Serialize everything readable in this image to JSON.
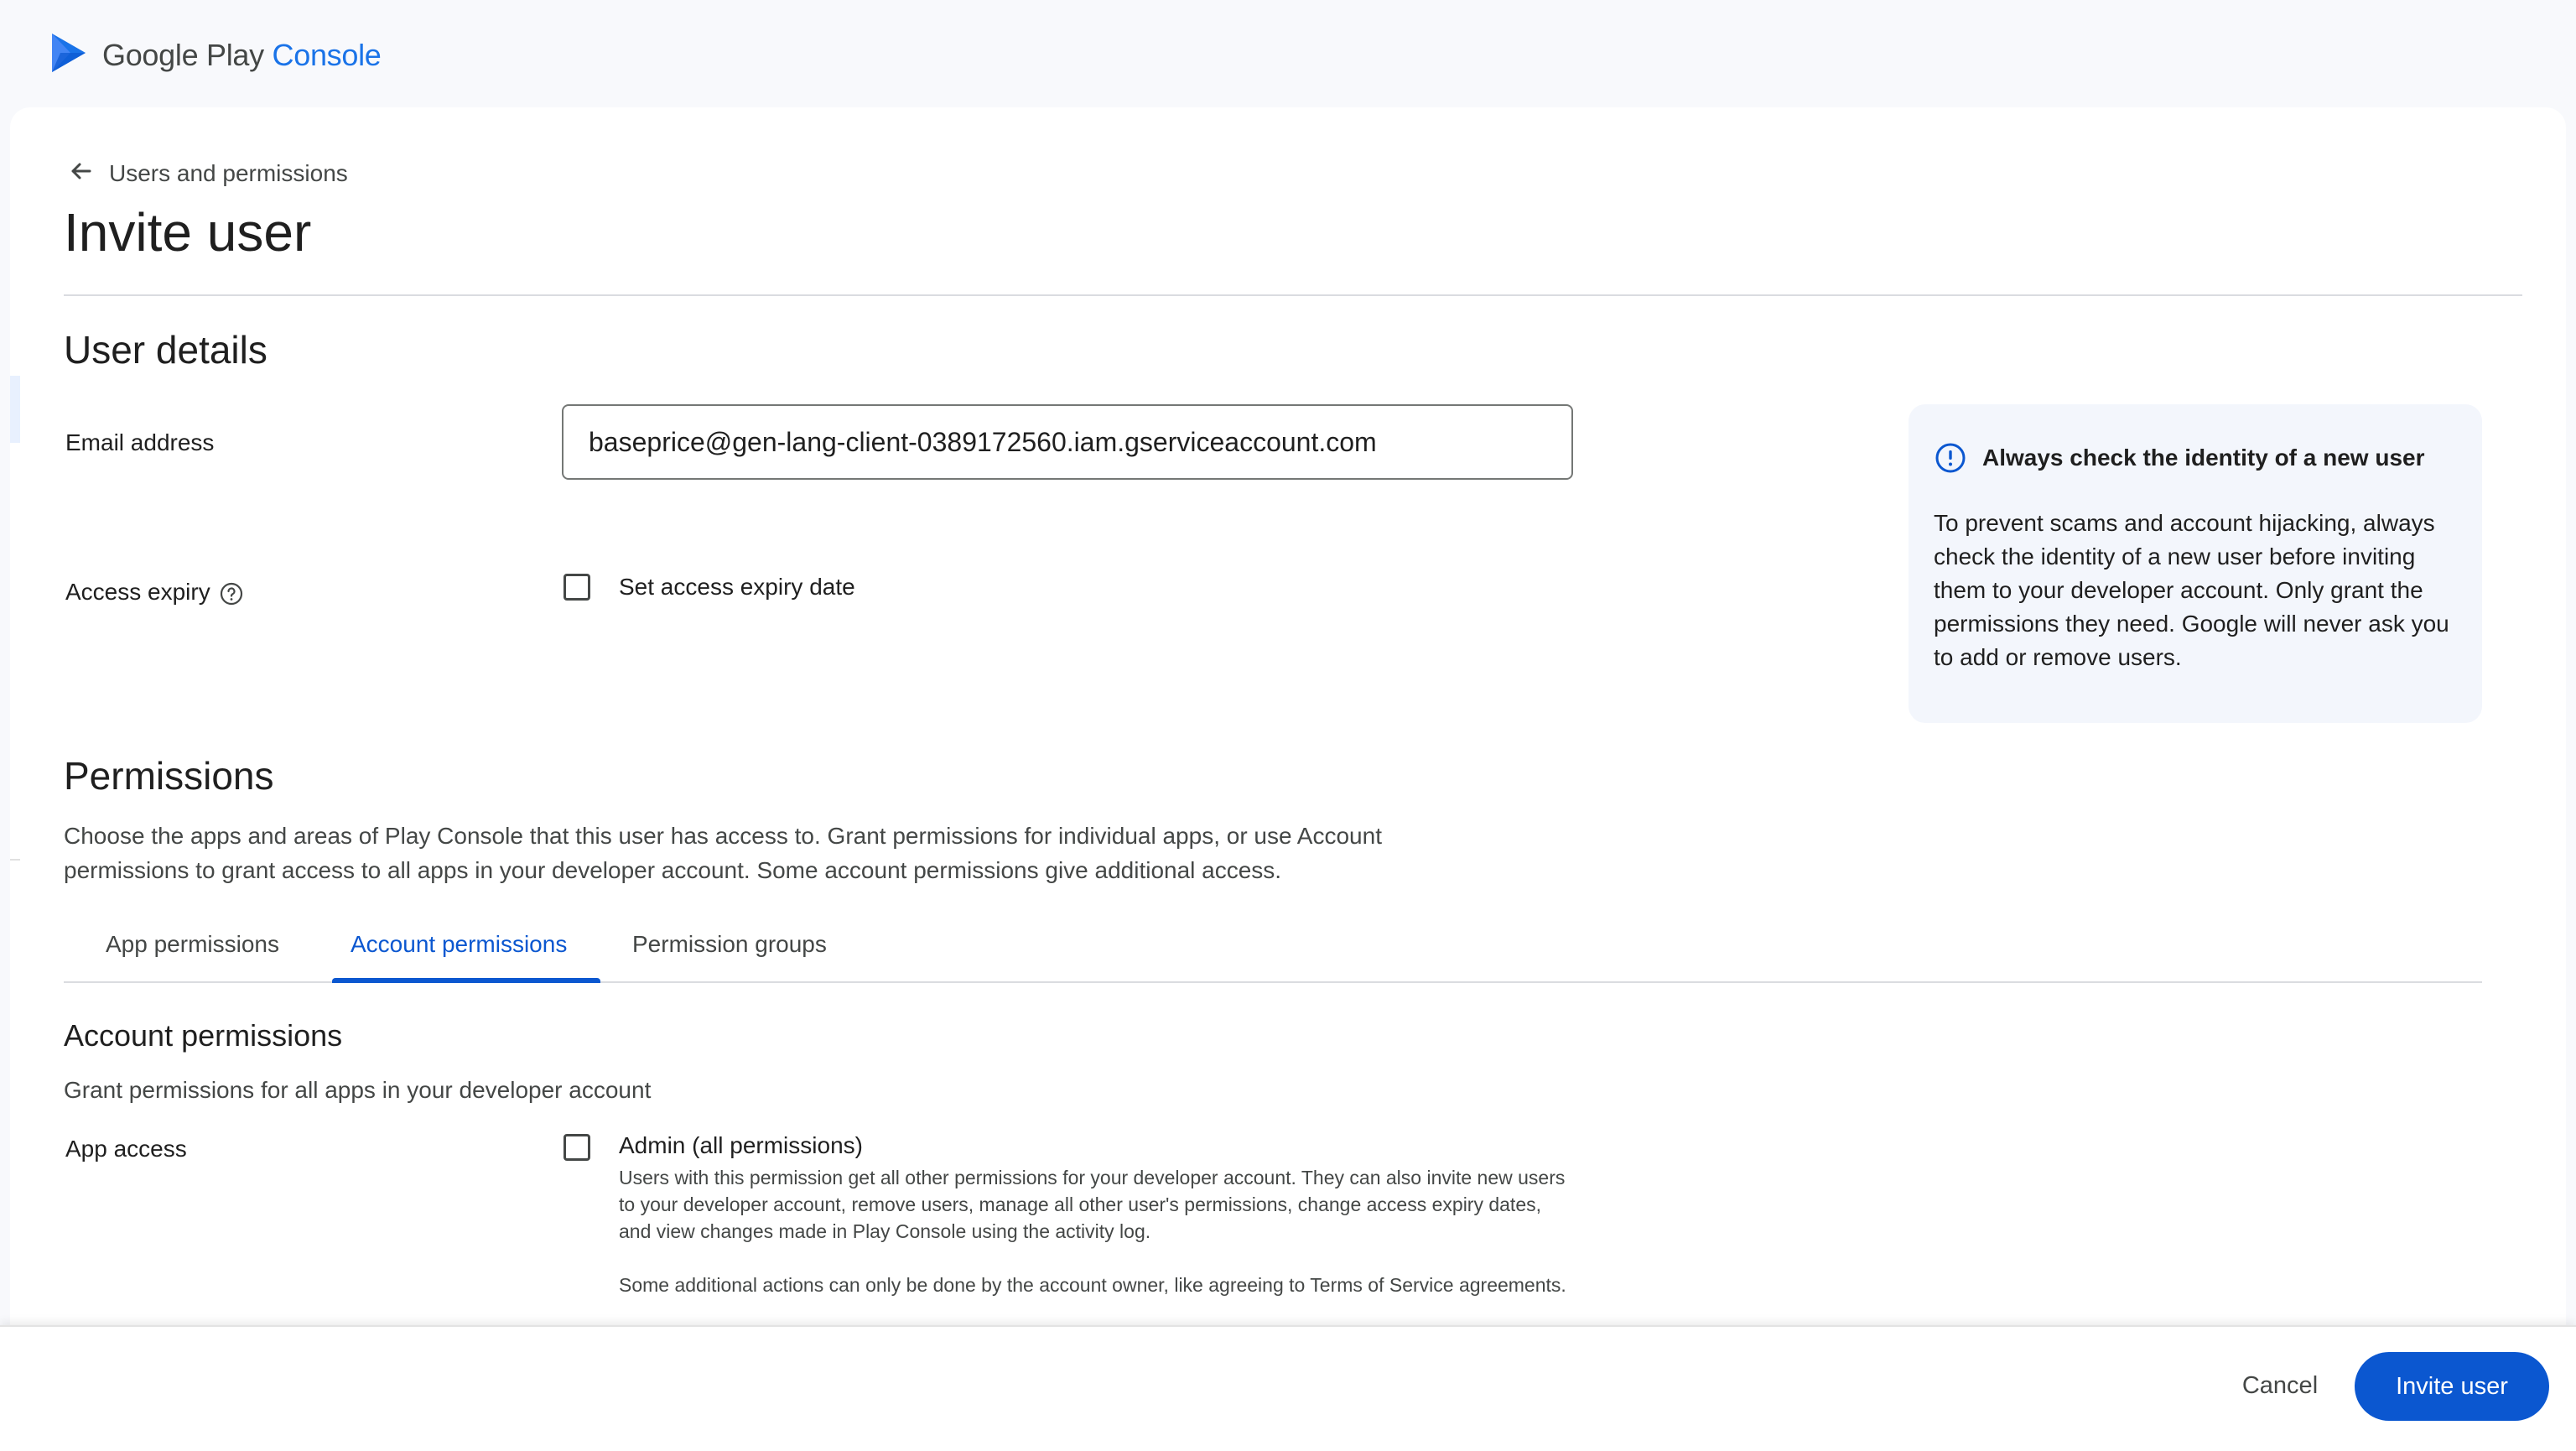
{
  "header": {
    "brand_primary": "Google Play",
    "brand_secondary": "Console"
  },
  "breadcrumb": {
    "back_label": "Users and permissions"
  },
  "page": {
    "title": "Invite user"
  },
  "user_details": {
    "heading": "User details",
    "email_label": "Email address",
    "email_value": "baseprice@gen-lang-client-0389172560.iam.gserviceaccount.com",
    "expiry_label": "Access expiry",
    "expiry_checkbox_label": "Set access expiry date",
    "expiry_checked": false
  },
  "info_card": {
    "title": "Always check the identity of a new user",
    "body": "To prevent scams and account hijacking, always check the identity of a new user before inviting them to your developer account. Only grant the permissions they need. Google will never ask you to add or remove users."
  },
  "permissions": {
    "heading": "Permissions",
    "description": "Choose the apps and areas of Play Console that this user has access to. Grant permissions for individual apps, or use Account permissions to grant access to all apps in your developer account. Some account permissions give additional access.",
    "tabs": [
      {
        "label": "App permissions",
        "active": false
      },
      {
        "label": "Account permissions",
        "active": true
      },
      {
        "label": "Permission groups",
        "active": false
      }
    ],
    "account": {
      "heading": "Account permissions",
      "subtext": "Grant permissions for all apps in your developer account",
      "app_access_label": "App access",
      "admin_label": "Admin (all permissions)",
      "admin_checked": false,
      "admin_desc_1": "Users with this permission get all other permissions for your developer account. They can also invite new users to your developer account, remove users, manage all other user's permissions, change access expiry dates, and view changes made in Play Console using the activity log.",
      "admin_desc_2": "Some additional actions can only be done by the account owner, like agreeing to Terms of Service agreements."
    }
  },
  "footer": {
    "cancel_label": "Cancel",
    "invite_label": "Invite user"
  },
  "colors": {
    "accent": "#0b57d0",
    "brand_blue": "#1a73e8",
    "info_bg": "#f3f6fc"
  },
  "icons": {
    "logo": "play-console-logo-icon",
    "back": "arrow-left-icon",
    "help": "help-circle-icon",
    "info": "alert-circle-icon"
  }
}
